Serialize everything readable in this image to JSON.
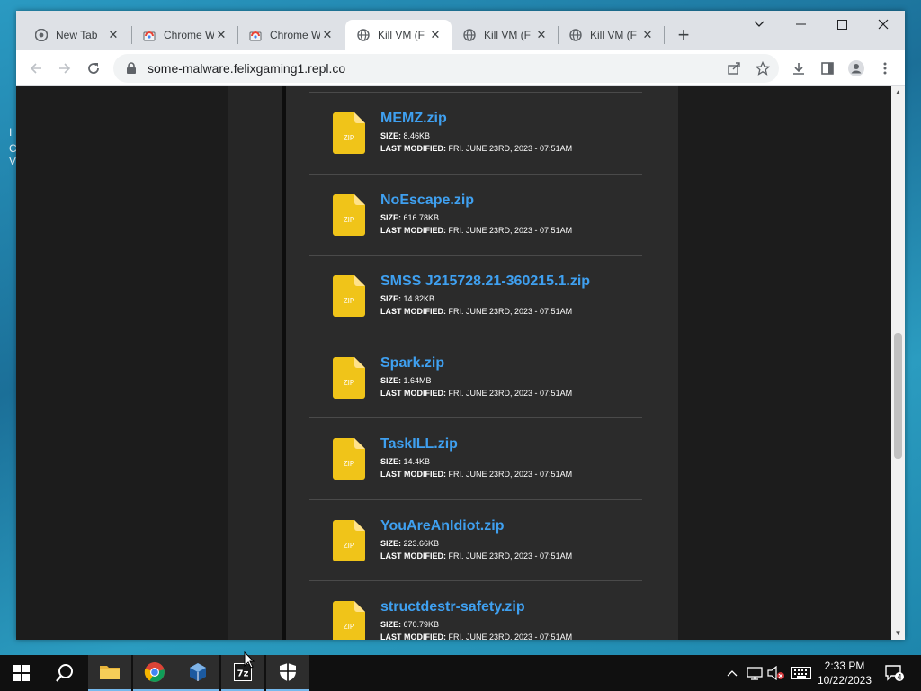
{
  "desktop": {
    "fragments": [
      "I",
      "C",
      "V"
    ]
  },
  "browser": {
    "tabs": [
      {
        "title": "New Tab",
        "icon": "chrome-icon",
        "active": false
      },
      {
        "title": "Chrome W",
        "icon": "chrome-web-store-icon",
        "active": false
      },
      {
        "title": "Chrome W",
        "icon": "chrome-web-store-icon",
        "active": false
      },
      {
        "title": "Kill VM (F",
        "icon": "globe-icon",
        "active": true
      },
      {
        "title": "Kill VM (F",
        "icon": "globe-icon",
        "active": false
      },
      {
        "title": "Kill VM (F",
        "icon": "globe-icon",
        "active": false
      }
    ],
    "new_tab_label": "+",
    "url": "some-malware.felixgaming1.repl.co"
  },
  "files": [
    {
      "name": "MEMZ.zip",
      "size": "8.46KB",
      "modified": "FRI. JUNE 23RD, 2023 - 07:51AM",
      "badge": "ZIP"
    },
    {
      "name": "NoEscape.zip",
      "size": "616.78KB",
      "modified": "FRI. JUNE 23RD, 2023 - 07:51AM",
      "badge": "ZIP"
    },
    {
      "name": "SMSS J215728.21-360215.1.zip",
      "size": "14.82KB",
      "modified": "FRI. JUNE 23RD, 2023 - 07:51AM",
      "badge": "ZIP"
    },
    {
      "name": "Spark.zip",
      "size": "1.64MB",
      "modified": "FRI. JUNE 23RD, 2023 - 07:51AM",
      "badge": "ZIP"
    },
    {
      "name": "TaskILL.zip",
      "size": "14.4KB",
      "modified": "FRI. JUNE 23RD, 2023 - 07:51AM",
      "badge": "ZIP"
    },
    {
      "name": "YouAreAnIdiot.zip",
      "size": "223.66KB",
      "modified": "FRI. JUNE 23RD, 2023 - 07:51AM",
      "badge": "ZIP"
    },
    {
      "name": "structdestr-safety.zip",
      "size": "670.79KB",
      "modified": "FRI. JUNE 23RD, 2023 - 07:51AM",
      "badge": "ZIP"
    }
  ],
  "labels": {
    "size": "SIZE:",
    "modified": "LAST MODIFIED:"
  },
  "taskbar": {
    "time": "2:33 PM",
    "date": "10/22/2023",
    "notifications": "4",
    "apps": [
      "windows-start",
      "search",
      "file-explorer",
      "chrome",
      "virtualbox",
      "7zip",
      "windows-security"
    ]
  },
  "colors": {
    "link": "#3fa0f0",
    "zip_icon": "#f0c419",
    "page_bg": "#2b2b2b"
  }
}
